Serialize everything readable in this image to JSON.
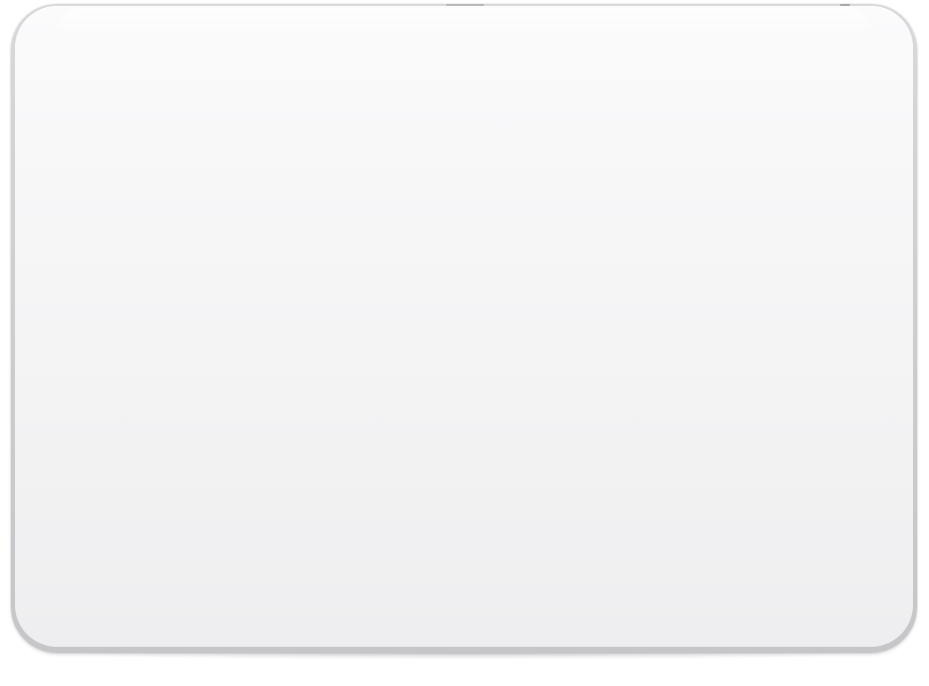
{
  "scene": {
    "background_color": "#ffffff",
    "device": {
      "rim_color": "#cfcfd2",
      "surface_color": "#f4f4f5"
    }
  }
}
